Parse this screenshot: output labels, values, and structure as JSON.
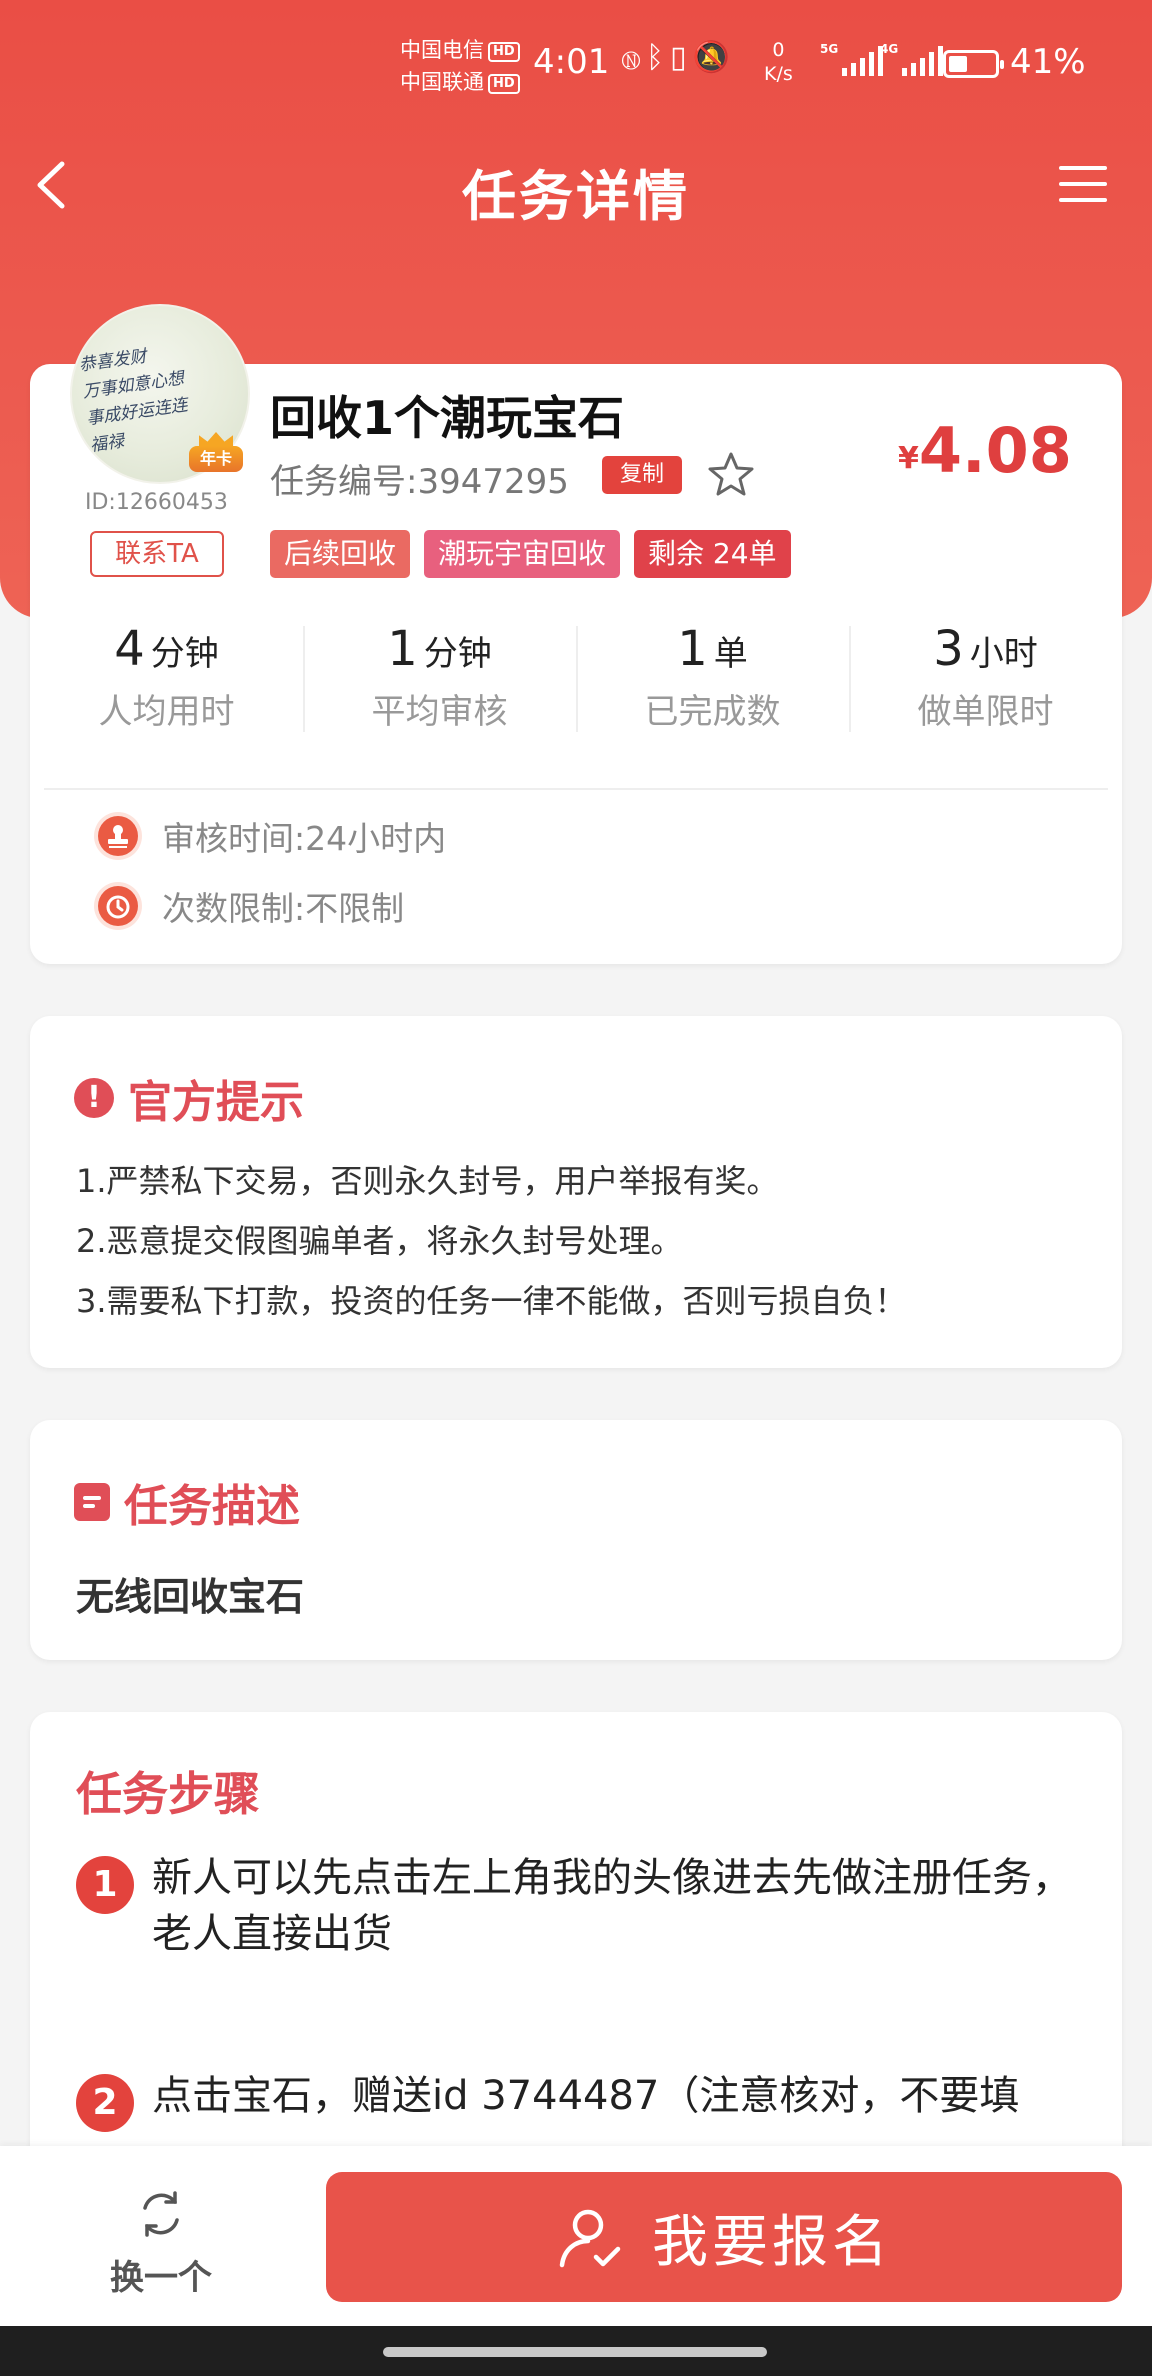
{
  "status_bar": {
    "carrier1": "中国电信",
    "carrier2": "中国联通",
    "hd": "HD",
    "time": "4:01",
    "net_speed_value": "0",
    "net_speed_unit": "K/s",
    "sig1_label": "5G",
    "sig2_label": "4G",
    "battery_level": 0.41,
    "battery_text": "41%",
    "icons": [
      "nfc-icon",
      "bluetooth-icon",
      "vibrate-icon",
      "mute-bell-icon"
    ]
  },
  "nav": {
    "title": "任务详情"
  },
  "task": {
    "user_id": "ID:12660453",
    "year_badge": "年卡",
    "contact_label": "联系TA",
    "title": "回收1个潮玩宝石",
    "task_no": "任务编号:3947295",
    "copy_label": "复制",
    "price_currency": "¥",
    "price_value": "4.08",
    "tags": [
      {
        "label": "后续回收",
        "color": "#ea6a62"
      },
      {
        "label": "潮玩宇宙回收",
        "color": "#e8607e"
      },
      {
        "label": "剩余 24单",
        "color": "#e0424a"
      }
    ],
    "stats": [
      {
        "value": "4",
        "unit": "分钟",
        "label": "人均用时"
      },
      {
        "value": "1",
        "unit": "分钟",
        "label": "平均审核"
      },
      {
        "value": "1",
        "unit": "单",
        "label": "已完成数"
      },
      {
        "value": "3",
        "unit": "小时",
        "label": "做单限时"
      }
    ],
    "review_time": "审核时间:24小时内",
    "limit": "次数限制:不限制"
  },
  "tips": {
    "title": "官方提示",
    "lines": [
      "1.严禁私下交易，否则永久封号，用户举报有奖。",
      "2.恶意提交假图骗单者，将永久封号处理。",
      "3.需要私下打款，投资的任务一律不能做，否则亏损自负！"
    ]
  },
  "description": {
    "title": "任务描述",
    "text": "无线回收宝石"
  },
  "steps": {
    "title": "任务步骤",
    "items": [
      {
        "num": "1",
        "text": "新人可以先点击左上角我的头像进去先做注册任务，老人直接出货"
      },
      {
        "num": "2",
        "text": "点击宝石，赠送id  3744487（注意核对，不要填"
      }
    ]
  },
  "bottom": {
    "switch_label": "换一个",
    "signup_label": "我要报名"
  }
}
